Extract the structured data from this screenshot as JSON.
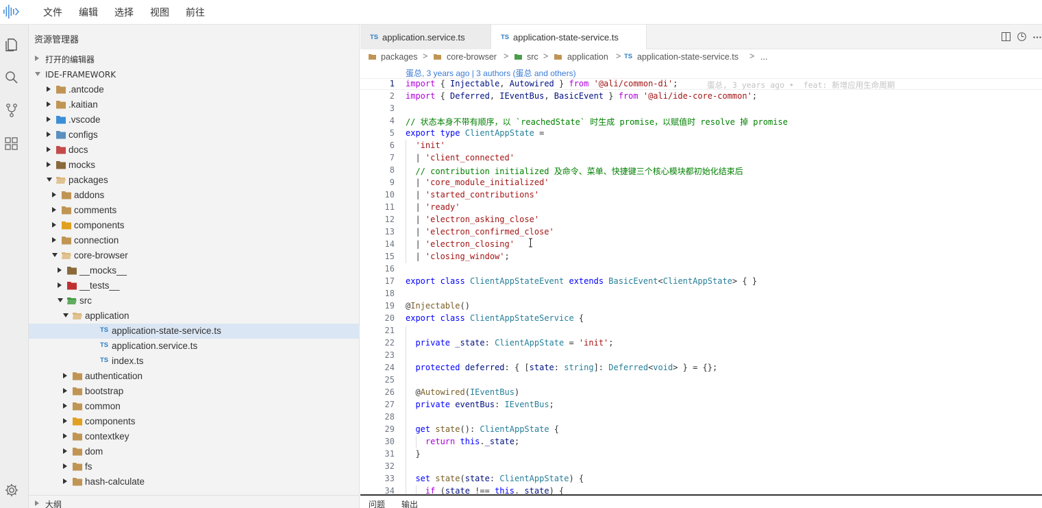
{
  "menubar": {
    "items": [
      "文件",
      "编辑",
      "选择",
      "视图",
      "前往"
    ]
  },
  "activitybar": {
    "icons": [
      "files-icon",
      "search-icon",
      "source-control-icon",
      "extensions-icon",
      "settings-gear-icon"
    ]
  },
  "sidebar": {
    "title": "资源管理器",
    "open_editors": "打开的编辑器",
    "project": "IDE-FRAMEWORK",
    "outline": "大纲",
    "tree": [
      {
        "label": ".antcode",
        "depth": 0,
        "expanded": false,
        "type": "folder"
      },
      {
        "label": ".kaitian",
        "depth": 0,
        "expanded": false,
        "type": "folder"
      },
      {
        "label": ".vscode",
        "depth": 0,
        "expanded": false,
        "type": "folder-vscode"
      },
      {
        "label": "configs",
        "depth": 0,
        "expanded": false,
        "type": "folder-config"
      },
      {
        "label": "docs",
        "depth": 0,
        "expanded": false,
        "type": "folder-docs"
      },
      {
        "label": "mocks",
        "depth": 0,
        "expanded": false,
        "type": "folder-mocks"
      },
      {
        "label": "packages",
        "depth": 0,
        "expanded": true,
        "type": "folder-open"
      },
      {
        "label": "addons",
        "depth": 1,
        "expanded": false,
        "type": "folder"
      },
      {
        "label": "comments",
        "depth": 1,
        "expanded": false,
        "type": "folder"
      },
      {
        "label": "components",
        "depth": 1,
        "expanded": false,
        "type": "folder-components"
      },
      {
        "label": "connection",
        "depth": 1,
        "expanded": false,
        "type": "folder"
      },
      {
        "label": "core-browser",
        "depth": 1,
        "expanded": true,
        "type": "folder-open"
      },
      {
        "label": "__mocks__",
        "depth": 2,
        "expanded": false,
        "type": "folder-mocks"
      },
      {
        "label": "__tests__",
        "depth": 2,
        "expanded": false,
        "type": "folder-tests"
      },
      {
        "label": "src",
        "depth": 2,
        "expanded": true,
        "type": "folder-src"
      },
      {
        "label": "application",
        "depth": 3,
        "expanded": true,
        "type": "folder-open"
      },
      {
        "label": "application-state-service.ts",
        "depth": 4,
        "type": "ts",
        "selected": true
      },
      {
        "label": "application.service.ts",
        "depth": 4,
        "type": "ts"
      },
      {
        "label": "index.ts",
        "depth": 4,
        "type": "ts"
      },
      {
        "label": "authentication",
        "depth": 3,
        "expanded": false,
        "type": "folder"
      },
      {
        "label": "bootstrap",
        "depth": 3,
        "expanded": false,
        "type": "folder"
      },
      {
        "label": "common",
        "depth": 3,
        "expanded": false,
        "type": "folder"
      },
      {
        "label": "components",
        "depth": 3,
        "expanded": false,
        "type": "folder-components"
      },
      {
        "label": "contextkey",
        "depth": 3,
        "expanded": false,
        "type": "folder"
      },
      {
        "label": "dom",
        "depth": 3,
        "expanded": false,
        "type": "folder"
      },
      {
        "label": "fs",
        "depth": 3,
        "expanded": false,
        "type": "folder"
      },
      {
        "label": "hash-calculate",
        "depth": 3,
        "expanded": false,
        "type": "folder"
      }
    ]
  },
  "tabs": [
    {
      "label": "application.service.ts",
      "badge": "TS",
      "active": false
    },
    {
      "label": "application-state-service.ts",
      "badge": "TS",
      "active": true
    }
  ],
  "breadcrumb": {
    "items": [
      "packages",
      "core-browser",
      "src",
      "application",
      "application-state-service.ts",
      "..."
    ],
    "file_badge": "TS"
  },
  "editor": {
    "blame_header": "蛋总, 3 years ago | 3 authors (蛋总 and others)",
    "inline_blame": "蛋总, 3 years ago •  feat: 新增应用生命周期",
    "current_line": 1,
    "line_numbers": [
      "1",
      "2",
      "3",
      "4",
      "5",
      "6",
      "7",
      "8",
      "9",
      "10",
      "11",
      "12",
      "13",
      "14",
      "15",
      "16",
      "17",
      "18",
      "19",
      "20",
      "21",
      "22",
      "23",
      "24",
      "25",
      "26",
      "27",
      "28",
      "29",
      "30",
      "31",
      "32",
      "33",
      "34"
    ],
    "lines": [
      [
        [
          "kw",
          "import"
        ],
        [
          "pl",
          " { "
        ],
        [
          "id",
          "Injectable"
        ],
        [
          "pl",
          ", "
        ],
        [
          "id",
          "Autowired"
        ],
        [
          "pl",
          " } "
        ],
        [
          "kw",
          "from"
        ],
        [
          "pl",
          " "
        ],
        [
          "str",
          "'@ali/common-di'"
        ],
        [
          "pl",
          ";"
        ]
      ],
      [
        [
          "kw",
          "import"
        ],
        [
          "pl",
          " { "
        ],
        [
          "id",
          "Deferred"
        ],
        [
          "pl",
          ", "
        ],
        [
          "id",
          "IEventBus"
        ],
        [
          "pl",
          ", "
        ],
        [
          "id",
          "BasicEvent"
        ],
        [
          "pl",
          " } "
        ],
        [
          "kw",
          "from"
        ],
        [
          "pl",
          " "
        ],
        [
          "str",
          "'@ali/ide-core-common'"
        ],
        [
          "pl",
          ";"
        ]
      ],
      [],
      [
        [
          "cm",
          "// 状态本身不带有顺序，以 `reachedState` 时生成 promise，以赋值时 resolve 掉 promise"
        ]
      ],
      [
        [
          "kw2",
          "export"
        ],
        [
          "pl",
          " "
        ],
        [
          "kw2",
          "type"
        ],
        [
          "pl",
          " "
        ],
        [
          "ty",
          "ClientAppState"
        ],
        [
          "pl",
          " ="
        ]
      ],
      [
        [
          "pl",
          "  "
        ],
        [
          "str",
          "'init'"
        ]
      ],
      [
        [
          "pl",
          "  | "
        ],
        [
          "str",
          "'client_connected'"
        ]
      ],
      [
        [
          "pl",
          "  "
        ],
        [
          "cm",
          "// contribution initialized 及命令、菜单、快捷键三个核心模块都初始化结束后"
        ]
      ],
      [
        [
          "pl",
          "  | "
        ],
        [
          "str",
          "'core_module_initialized'"
        ]
      ],
      [
        [
          "pl",
          "  | "
        ],
        [
          "str",
          "'started_contributions'"
        ]
      ],
      [
        [
          "pl",
          "  | "
        ],
        [
          "str",
          "'ready'"
        ]
      ],
      [
        [
          "pl",
          "  | "
        ],
        [
          "str",
          "'electron_asking_close'"
        ]
      ],
      [
        [
          "pl",
          "  | "
        ],
        [
          "str",
          "'electron_confirmed_close'"
        ]
      ],
      [
        [
          "pl",
          "  | "
        ],
        [
          "str",
          "'electron_closing'"
        ]
      ],
      [
        [
          "pl",
          "  | "
        ],
        [
          "str",
          "'closing_window'"
        ],
        [
          "pl",
          ";"
        ]
      ],
      [],
      [
        [
          "kw2",
          "export"
        ],
        [
          "pl",
          " "
        ],
        [
          "kw2",
          "class"
        ],
        [
          "pl",
          " "
        ],
        [
          "ty",
          "ClientAppStateEvent"
        ],
        [
          "pl",
          " "
        ],
        [
          "kw2",
          "extends"
        ],
        [
          "pl",
          " "
        ],
        [
          "ty",
          "BasicEvent"
        ],
        [
          "pl",
          "<"
        ],
        [
          "ty",
          "ClientAppState"
        ],
        [
          "pl",
          "> { }"
        ]
      ],
      [],
      [
        [
          "pl",
          "@"
        ],
        [
          "fn",
          "Injectable"
        ],
        [
          "pl",
          "()"
        ]
      ],
      [
        [
          "kw2",
          "export"
        ],
        [
          "pl",
          " "
        ],
        [
          "kw2",
          "class"
        ],
        [
          "pl",
          " "
        ],
        [
          "ty",
          "ClientAppStateService"
        ],
        [
          "pl",
          " {"
        ]
      ],
      [],
      [
        [
          "pl",
          "  "
        ],
        [
          "kw2",
          "private"
        ],
        [
          "pl",
          " "
        ],
        [
          "id",
          "_state"
        ],
        [
          "pl",
          ": "
        ],
        [
          "ty",
          "ClientAppState"
        ],
        [
          "pl",
          " = "
        ],
        [
          "str",
          "'init'"
        ],
        [
          "pl",
          ";"
        ]
      ],
      [],
      [
        [
          "pl",
          "  "
        ],
        [
          "kw2",
          "protected"
        ],
        [
          "pl",
          " "
        ],
        [
          "id",
          "deferred"
        ],
        [
          "pl",
          ": { ["
        ],
        [
          "id",
          "state"
        ],
        [
          "pl",
          ": "
        ],
        [
          "ty",
          "string"
        ],
        [
          "pl",
          "]: "
        ],
        [
          "ty",
          "Deferred"
        ],
        [
          "pl",
          "<"
        ],
        [
          "ty",
          "void"
        ],
        [
          "pl",
          "> } = {};"
        ]
      ],
      [],
      [
        [
          "pl",
          "  @"
        ],
        [
          "fn",
          "Autowired"
        ],
        [
          "pl",
          "("
        ],
        [
          "ty",
          "IEventBus"
        ],
        [
          "pl",
          ")"
        ]
      ],
      [
        [
          "pl",
          "  "
        ],
        [
          "kw2",
          "private"
        ],
        [
          "pl",
          " "
        ],
        [
          "id",
          "eventBus"
        ],
        [
          "pl",
          ": "
        ],
        [
          "ty",
          "IEventBus"
        ],
        [
          "pl",
          ";"
        ]
      ],
      [],
      [
        [
          "pl",
          "  "
        ],
        [
          "kw2",
          "get"
        ],
        [
          "pl",
          " "
        ],
        [
          "fn",
          "state"
        ],
        [
          "pl",
          "(): "
        ],
        [
          "ty",
          "ClientAppState"
        ],
        [
          "pl",
          " {"
        ]
      ],
      [
        [
          "pl",
          "    "
        ],
        [
          "kw",
          "return"
        ],
        [
          "pl",
          " "
        ],
        [
          "kw2",
          "this"
        ],
        [
          "pl",
          "."
        ],
        [
          "id",
          "_state"
        ],
        [
          "pl",
          ";"
        ]
      ],
      [
        [
          "pl",
          "  }"
        ]
      ],
      [],
      [
        [
          "pl",
          "  "
        ],
        [
          "kw2",
          "set"
        ],
        [
          "pl",
          " "
        ],
        [
          "fn",
          "state"
        ],
        [
          "pl",
          "("
        ],
        [
          "id",
          "state"
        ],
        [
          "pl",
          ": "
        ],
        [
          "ty",
          "ClientAppState"
        ],
        [
          "pl",
          ") {"
        ]
      ],
      [
        [
          "pl",
          "    "
        ],
        [
          "kw",
          "if"
        ],
        [
          "pl",
          " ("
        ],
        [
          "id",
          "state"
        ],
        [
          "pl",
          " !== "
        ],
        [
          "kw2",
          "this"
        ],
        [
          "pl",
          "."
        ],
        [
          "id",
          "_state"
        ],
        [
          "pl",
          ") {"
        ]
      ]
    ]
  },
  "panel": {
    "tabs": [
      "问题",
      "输出"
    ]
  },
  "colors": {
    "accent": "#2e7ec3",
    "selection": "#dbe6f4",
    "folder": "#c09553"
  }
}
